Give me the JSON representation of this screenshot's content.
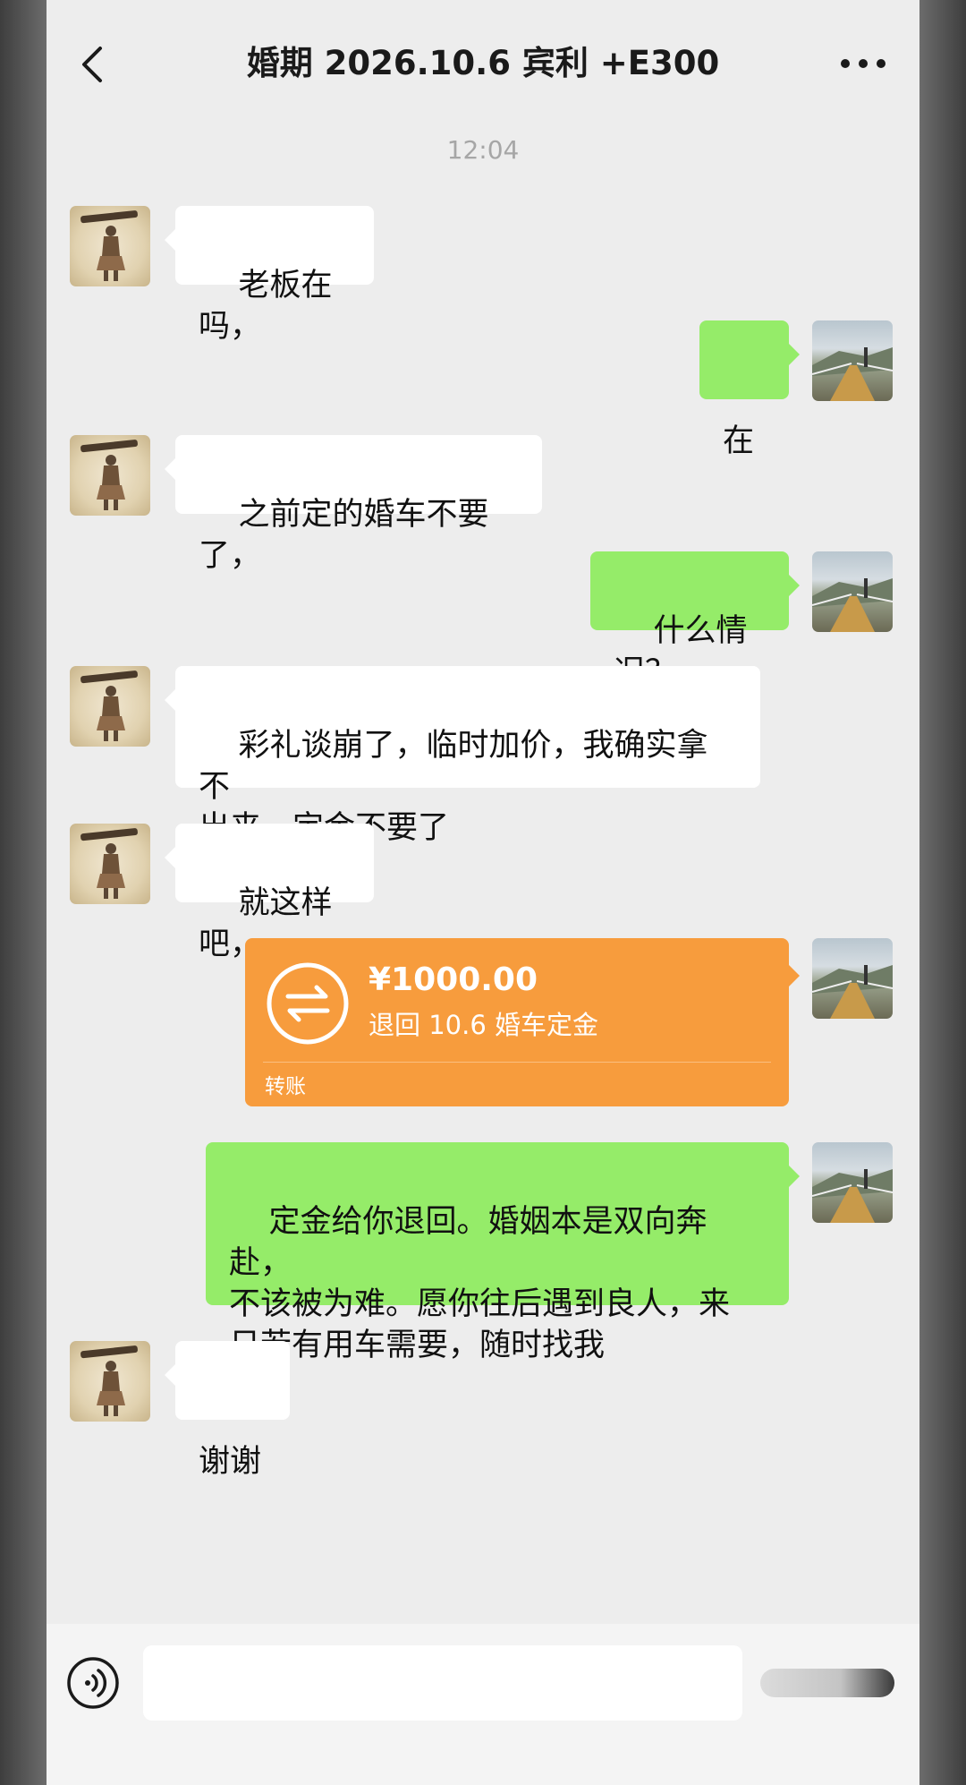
{
  "header": {
    "title": "婚期 2026.10.6 宾利 +E300"
  },
  "timestamp": "12:04",
  "messages": [
    {
      "sender": "other",
      "text": "老板在吗，"
    },
    {
      "sender": "self",
      "text": "在"
    },
    {
      "sender": "other",
      "text": "之前定的婚车不要了，"
    },
    {
      "sender": "self",
      "text": "什么情况？"
    },
    {
      "sender": "other",
      "text": "彩礼谈崩了，临时加价，我确实拿不\n出来，定金不要了"
    },
    {
      "sender": "other",
      "text": "就这样吧，"
    },
    {
      "sender": "self",
      "type": "transfer",
      "amount": "¥1000.00",
      "note": "退回 10.6 婚车定金",
      "label": "转账",
      "icon": "transfer-arrows-icon",
      "color": "#f79c3d"
    },
    {
      "sender": "self",
      "text": "定金给你退回。婚姻本是双向奔赴，\n不该被为难。愿你往后遇到良人，来\n日若有用车需要，随时找我"
    },
    {
      "sender": "other",
      "text": "谢谢"
    }
  ],
  "input": {
    "placeholder": ""
  },
  "colors": {
    "background": "#ededed",
    "self_bubble": "#95ec69",
    "other_bubble": "#ffffff",
    "transfer": "#f79c3d"
  }
}
